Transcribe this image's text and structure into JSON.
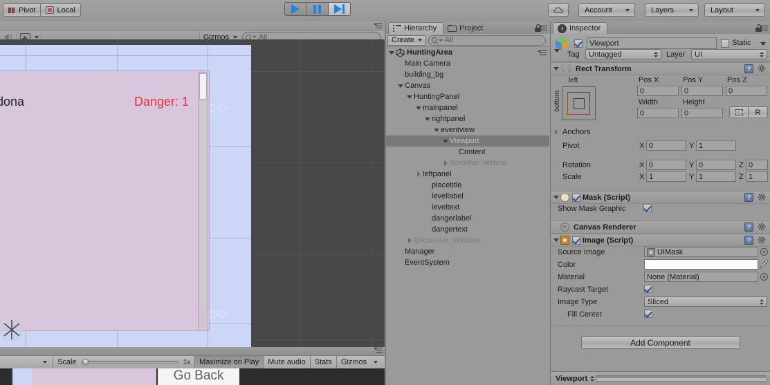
{
  "toolbar": {
    "pivot_label": "Pivot",
    "local_label": "Local",
    "play_label": "play-button",
    "pause_label": "pause-button",
    "step_label": "step-button",
    "cloud_label": "cloud-services",
    "account_label": "Account",
    "layers_label": "Layers",
    "layout_label": "Layout"
  },
  "scene": {
    "gizmos_label": "Gizmos",
    "search_placeholder": "All",
    "canvas_texts": {
      "place_title": "Doidona",
      "danger_text": "Danger: 1"
    }
  },
  "game_view": {
    "scale_label": "Scale",
    "scale_value": "1x",
    "maximize_label": "Maximize on Play",
    "mute_label": "Mute audio",
    "stats_label": "Stats",
    "gizmos_label": "Gizmos",
    "go_back_label": "Go Back"
  },
  "hierarchy": {
    "tab_label": "Hierarchy",
    "project_tab_label": "Project",
    "create_label": "Create",
    "search_placeholder": "All",
    "items": [
      {
        "label": "HuntingArea",
        "indent": 0,
        "arrow": "down",
        "icon": "unity",
        "bold": true,
        "selected": false,
        "disabled": false
      },
      {
        "label": "Main Camera",
        "indent": 1,
        "arrow": "none",
        "icon": "none",
        "bold": false,
        "selected": false,
        "disabled": false
      },
      {
        "label": "building_bg",
        "indent": 1,
        "arrow": "none",
        "icon": "none",
        "bold": false,
        "selected": false,
        "disabled": false
      },
      {
        "label": "Canvas",
        "indent": 1,
        "arrow": "down",
        "icon": "none",
        "bold": false,
        "selected": false,
        "disabled": false
      },
      {
        "label": "HuntingPanel",
        "indent": 2,
        "arrow": "down",
        "icon": "none",
        "bold": false,
        "selected": false,
        "disabled": false
      },
      {
        "label": "mainpanel",
        "indent": 3,
        "arrow": "down",
        "icon": "none",
        "bold": false,
        "selected": false,
        "disabled": false
      },
      {
        "label": "rightpanel",
        "indent": 4,
        "arrow": "down",
        "icon": "none",
        "bold": false,
        "selected": false,
        "disabled": false
      },
      {
        "label": "eventview",
        "indent": 5,
        "arrow": "down",
        "icon": "none",
        "bold": false,
        "selected": false,
        "disabled": false
      },
      {
        "label": "Viewport",
        "indent": 6,
        "arrow": "down",
        "icon": "none",
        "bold": false,
        "selected": true,
        "disabled": true
      },
      {
        "label": "Content",
        "indent": 7,
        "arrow": "none",
        "icon": "none",
        "bold": false,
        "selected": false,
        "disabled": false
      },
      {
        "label": "Scrollbar Vertical",
        "indent": 6,
        "arrow": "right",
        "icon": "none",
        "bold": false,
        "selected": false,
        "disabled": true
      },
      {
        "label": "leftpanel",
        "indent": 3,
        "arrow": "right",
        "icon": "none",
        "bold": false,
        "selected": false,
        "disabled": false
      },
      {
        "label": "placetitle",
        "indent": 4,
        "arrow": "none",
        "icon": "none",
        "bold": false,
        "selected": false,
        "disabled": false
      },
      {
        "label": "levellabel",
        "indent": 4,
        "arrow": "none",
        "icon": "none",
        "bold": false,
        "selected": false,
        "disabled": false
      },
      {
        "label": "leveltext",
        "indent": 4,
        "arrow": "none",
        "icon": "none",
        "bold": false,
        "selected": false,
        "disabled": false
      },
      {
        "label": "dangerlabel",
        "indent": 4,
        "arrow": "none",
        "icon": "none",
        "bold": false,
        "selected": false,
        "disabled": false
      },
      {
        "label": "dangertext",
        "indent": 4,
        "arrow": "none",
        "icon": "none",
        "bold": false,
        "selected": false,
        "disabled": false
      },
      {
        "label": "Encounter_Window",
        "indent": 2,
        "arrow": "right",
        "icon": "none",
        "bold": false,
        "selected": false,
        "disabled": true
      },
      {
        "label": "Manager",
        "indent": 1,
        "arrow": "none",
        "icon": "none",
        "bold": false,
        "selected": false,
        "disabled": false
      },
      {
        "label": "EventSystem",
        "indent": 1,
        "arrow": "none",
        "icon": "none",
        "bold": false,
        "selected": false,
        "disabled": false
      }
    ]
  },
  "inspector": {
    "tab_label": "Inspector",
    "object_name": "Viewport",
    "object_enabled": true,
    "static_label": "Static",
    "static_checked": false,
    "tag_label": "Tag",
    "tag_value": "Untagged",
    "layer_label": "Layer",
    "layer_value": "UI",
    "rect_transform": {
      "title": "Rect Transform",
      "anchor_preset_top": "left",
      "anchor_preset_side": "bottom",
      "pos_x_label": "Pos X",
      "pos_y_label": "Pos Y",
      "pos_z_label": "Pos Z",
      "pos_x": "0",
      "pos_y": "0",
      "pos_z": "0",
      "width_label": "Width",
      "height_label": "Height",
      "width": "0",
      "height": "0",
      "raw_label": "R",
      "anchors_label": "Anchors",
      "pivot_label": "Pivot",
      "pivot_x": "0",
      "pivot_y": "1",
      "rotation_label": "Rotation",
      "rot_x": "0",
      "rot_y": "0",
      "rot_z": "0",
      "scale_label": "Scale",
      "scale_x": "1",
      "scale_y": "1",
      "scale_z": "1",
      "axis_x": "X",
      "axis_y": "Y",
      "axis_z": "Z"
    },
    "mask": {
      "title": "Mask (Script)",
      "enabled": true,
      "show_mask_graphic_label": "Show Mask Graphic",
      "show_mask_graphic": true
    },
    "canvas_renderer": {
      "title": "Canvas Renderer"
    },
    "image": {
      "title": "Image (Script)",
      "enabled": true,
      "source_image_label": "Source Image",
      "source_image_value": "UIMask",
      "color_label": "Color",
      "color_value": "#ffffff",
      "material_label": "Material",
      "material_value": "None (Material)",
      "raycast_target_label": "Raycast Target",
      "raycast_target": true,
      "image_type_label": "Image Type",
      "image_type_value": "Sliced",
      "fill_center_label": "Fill Center",
      "fill_center": true
    },
    "add_component_label": "Add Component",
    "footer_label": "Viewport"
  }
}
